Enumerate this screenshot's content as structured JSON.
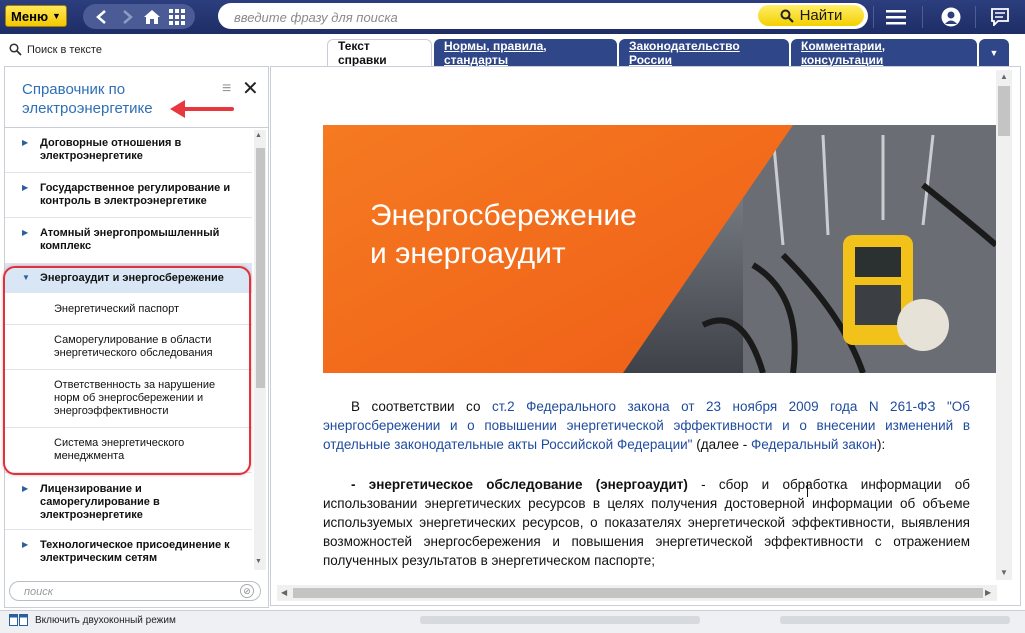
{
  "topbar": {
    "menu_label": "Меню",
    "search_placeholder": "введите фразу для поиска",
    "find_label": "Найти"
  },
  "left": {
    "search_in_text": "Поиск в тексте",
    "panel_title": "Справочник по электроэнергетике",
    "items": [
      {
        "label": "Договорные отношения в электроэнергетике"
      },
      {
        "label": "Государственное регулирование и контроль в электроэнергетике"
      },
      {
        "label": "Атомный энергопромышленный комплекс"
      },
      {
        "label": "Энергоаудит и энергосбережение"
      },
      {
        "label": "Лицензирование и саморегулирование в электроэнергетике"
      },
      {
        "label": "Технологическое присоединение к электрическим сетям"
      }
    ],
    "subitems": [
      {
        "label": "Энергетический паспорт"
      },
      {
        "label": "Саморегулирование в области энергетического обследования"
      },
      {
        "label": "Ответственность за нарушение норм об энергосбережении и энергоэффективности"
      },
      {
        "label": "Система энергетического менеджмента"
      }
    ],
    "filter_placeholder": "поиск"
  },
  "tabs": [
    {
      "label": "Текст справки"
    },
    {
      "label": "Нормы, правила, стандарты"
    },
    {
      "label": "Законодательство России"
    },
    {
      "label": "Комментарии, консультации"
    }
  ],
  "doc": {
    "banner_line1": "Энергосбережение",
    "banner_line2": "и энергоаудит",
    "p1_a": "В соответствии со ",
    "p1_link": "ст.2 Федерального закона от 23 ноября 2009 года N 261-ФЗ \"Об энергосбережении и о повышении энергетической эффективности и о внесении изменений в отдельные законодательные акты Российской Федерации\"",
    "p1_b": " (далее - ",
    "p1_link2": "Федеральный закон",
    "p1_c": "):",
    "p2_bold": "- энергетическое обследование (энергоаудит)",
    "p2_text": " - сбор и обработка информации об использовании энергетических ресурсов в целях получения достоверной информации об объеме используемых энергетических ресурсов, о показателях энергетической эффективности, выявления возможностей энергосбережения и повышения энергетической эффективности с отражением полученных результатов в энергетическом паспорте;"
  },
  "status": {
    "two_window": "Включить двухоконный режим"
  },
  "colors": {
    "topbar": "#1e2d66",
    "accent_yellow": "#f4d000",
    "tab_blue": "#2f4688",
    "highlight_red": "#e0313c",
    "banner_orange": "#f26a1b"
  }
}
